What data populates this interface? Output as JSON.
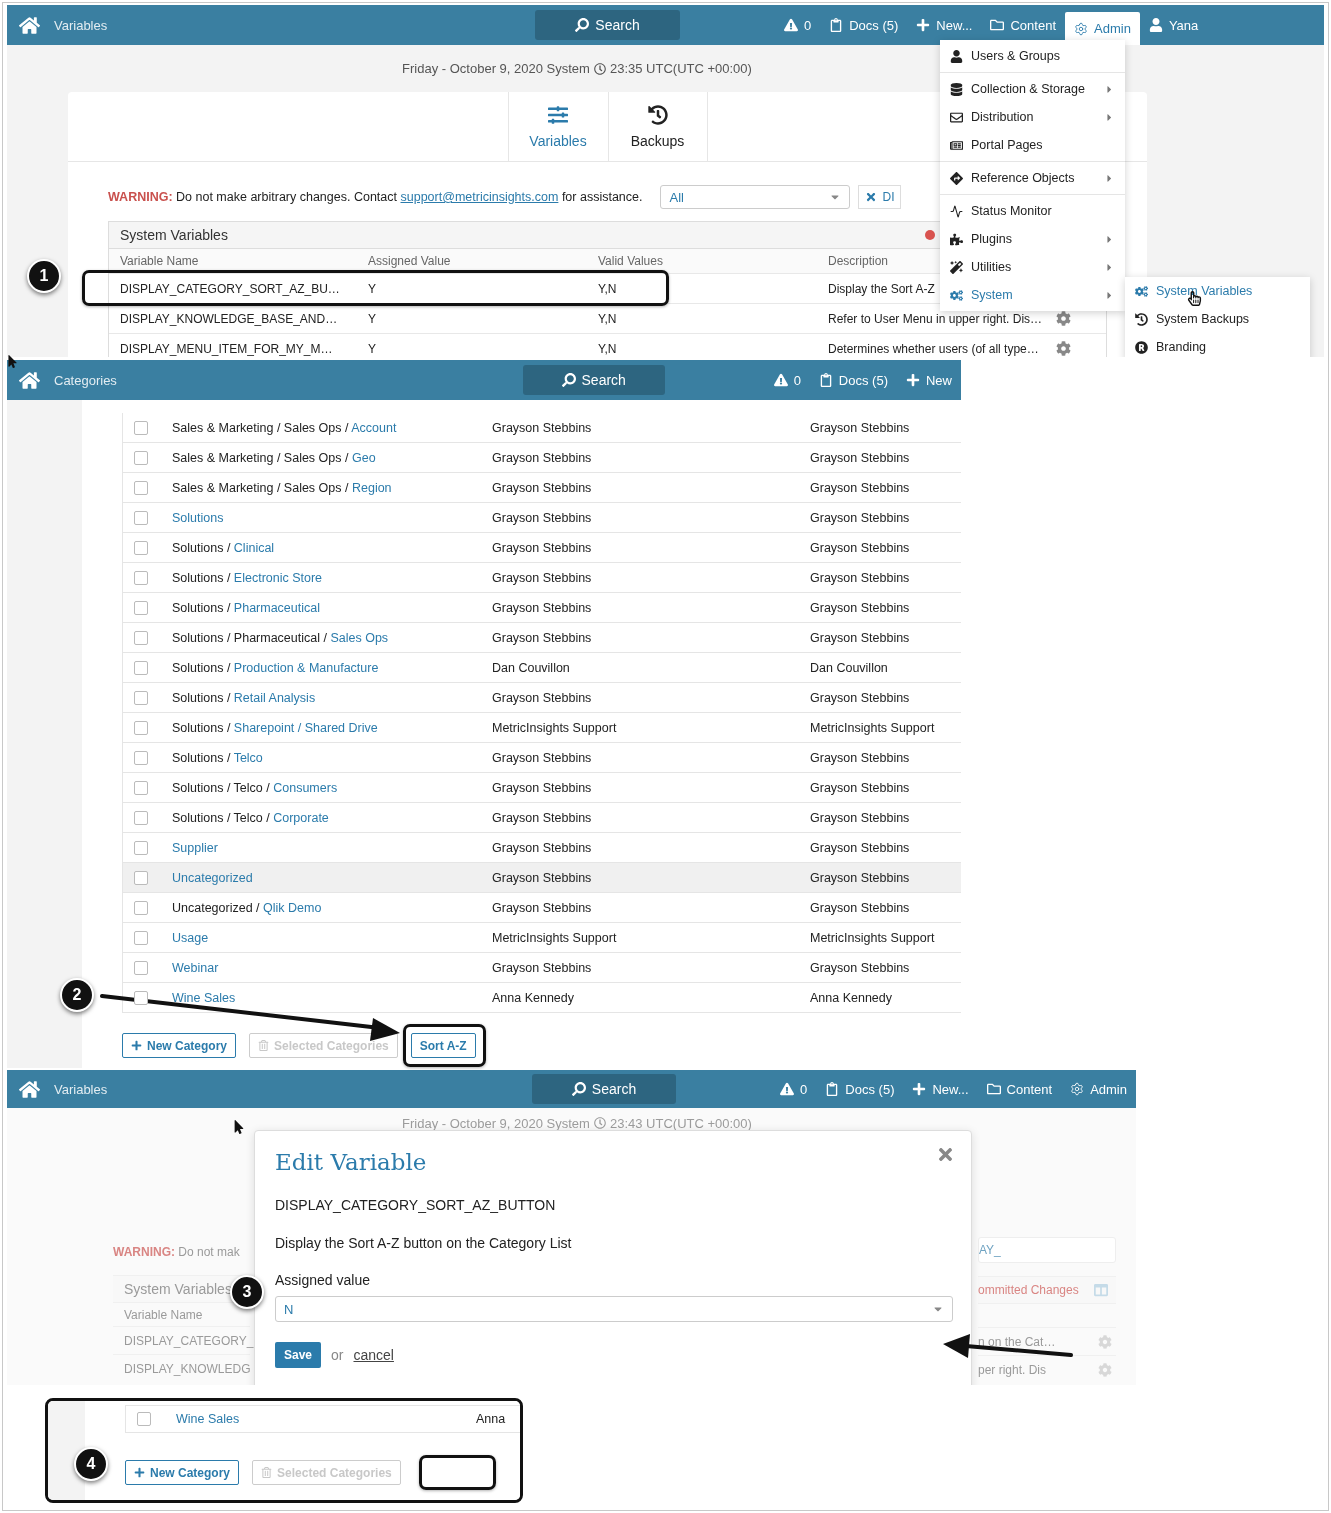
{
  "variables_screen": {
    "topbar": {
      "title": "Variables",
      "search": "Search",
      "nav": [
        {
          "kind": "alert",
          "label": "0",
          "selected": false
        },
        {
          "kind": "docs",
          "label": "Docs (5)",
          "selected": false
        },
        {
          "kind": "new",
          "label": "New...",
          "selected": false
        },
        {
          "kind": "content",
          "label": "Content",
          "selected": false
        },
        {
          "kind": "admin",
          "label": "Admin",
          "selected": true
        },
        {
          "kind": "user",
          "label": "Yana",
          "selected": false
        }
      ]
    },
    "datetime": {
      "date": "Friday - October 9, 2020 System",
      "time": "23:35 UTC(UTC +00:00)"
    },
    "tabs": [
      {
        "kind": "sliders",
        "label": "Variables",
        "selected": true
      },
      {
        "kind": "history",
        "label": "Backups",
        "selected": false
      }
    ],
    "warning": {
      "label": "WARNING:",
      "text": "Do not make arbitrary changes. Contact",
      "link": "support@metricinsights.com",
      "text_end": "for assistance."
    },
    "filter": {
      "value": "All"
    },
    "clear_button": "DI",
    "table": {
      "title": "System Variables",
      "columns": [
        "Variable Name",
        "Assigned Value",
        "Valid Values",
        "Description"
      ],
      "rows": [
        {
          "cells": [
            "DISPLAY_CATEGORY_SORT_AZ_BU…",
            "Y",
            "Y,N",
            "Display the Sort A-Z"
          ],
          "gear": false
        },
        {
          "cells": [
            "DISPLAY_KNOWLEDGE_BASE_AND…",
            "Y",
            "Y,N",
            "Refer to User Menu in upper right. Dis…"
          ],
          "gear": true
        },
        {
          "cells": [
            "DISPLAY_MENU_ITEM_FOR_MY_M…",
            "Y",
            "Y,N",
            "Determines whether users (of all type…"
          ],
          "gear": true
        }
      ]
    },
    "admin_menu": [
      [
        {
          "kind": "user",
          "label": "Users & Groups",
          "submenu": false,
          "selected": false
        }
      ],
      [
        {
          "kind": "database",
          "label": "Collection & Storage",
          "submenu": true,
          "selected": false
        },
        {
          "kind": "mail",
          "label": "Distribution",
          "submenu": true,
          "selected": false
        },
        {
          "kind": "newspaper",
          "label": "Portal Pages",
          "submenu": false,
          "selected": false
        }
      ],
      [
        {
          "kind": "signpost",
          "label": "Reference Objects",
          "submenu": true,
          "selected": false
        }
      ],
      [
        {
          "kind": "pulse",
          "label": "Status Monitor",
          "submenu": false,
          "selected": false
        },
        {
          "kind": "puzzle",
          "label": "Plugins",
          "submenu": true,
          "selected": false
        },
        {
          "kind": "wand",
          "label": "Utilities",
          "submenu": true,
          "selected": false
        },
        {
          "kind": "gears",
          "label": "System",
          "submenu": true,
          "selected": true
        }
      ]
    ],
    "submenu": [
      {
        "kind": "gears",
        "label": "System Variables",
        "selected": true
      },
      {
        "kind": "history",
        "label": "System Backups",
        "selected": false
      },
      {
        "kind": "registered",
        "label": "Branding",
        "selected": false
      }
    ]
  },
  "categories_screen": {
    "topbar": {
      "title": "Categories",
      "search": "Search",
      "nav": [
        {
          "kind": "alert",
          "label": "0",
          "selected": false
        },
        {
          "kind": "docs",
          "label": "Docs (5)",
          "selected": false
        },
        {
          "kind": "new",
          "label": "New",
          "selected": false
        }
      ]
    },
    "rows": [
      {
        "path": "Sales & Marketing / Sales Ops /",
        "name": "Account",
        "column_2": "Grayson Stebbins",
        "column_3": "Grayson Stebbins",
        "checked": false,
        "highlighted": false
      },
      {
        "path": "Sales & Marketing / Sales Ops /",
        "name": "Geo",
        "column_2": "Grayson Stebbins",
        "column_3": "Grayson Stebbins",
        "checked": false,
        "highlighted": false
      },
      {
        "path": "Sales & Marketing / Sales Ops /",
        "name": "Region",
        "column_2": "Grayson Stebbins",
        "column_3": "Grayson Stebbins",
        "checked": false,
        "highlighted": false
      },
      {
        "name": "Solutions",
        "column_2": "Grayson Stebbins",
        "column_3": "Grayson Stebbins",
        "checked": false,
        "highlighted": false
      },
      {
        "path": "Solutions /",
        "name": "Clinical",
        "column_2": "Grayson Stebbins",
        "column_3": "Grayson Stebbins",
        "checked": false,
        "highlighted": false
      },
      {
        "path": "Solutions /",
        "name": "Electronic Store",
        "column_2": "Grayson Stebbins",
        "column_3": "Grayson Stebbins",
        "checked": false,
        "highlighted": false
      },
      {
        "path": "Solutions /",
        "name": "Pharmaceutical",
        "column_2": "Grayson Stebbins",
        "column_3": "Grayson Stebbins",
        "checked": false,
        "highlighted": false
      },
      {
        "path": "Solutions / Pharmaceutical /",
        "name": "Sales Ops",
        "column_2": "Grayson Stebbins",
        "column_3": "Grayson Stebbins",
        "checked": false,
        "highlighted": false
      },
      {
        "path": "Solutions /",
        "name": "Production & Manufacture",
        "column_2": "Dan Couvillon",
        "column_3": "Dan Couvillon",
        "checked": false,
        "highlighted": false
      },
      {
        "path": "Solutions /",
        "name": "Retail Analysis",
        "column_2": "Grayson Stebbins",
        "column_3": "Grayson Stebbins",
        "checked": false,
        "highlighted": false
      },
      {
        "path": "Solutions /",
        "name": "Sharepoint / Shared Drive",
        "column_2": "MetricInsights Support",
        "column_3": "MetricInsights Support",
        "checked": false,
        "highlighted": false
      },
      {
        "path": "Solutions /",
        "name": "Telco",
        "column_2": "Grayson Stebbins",
        "column_3": "Grayson Stebbins",
        "checked": false,
        "highlighted": false
      },
      {
        "path": "Solutions / Telco /",
        "name": "Consumers",
        "column_2": "Grayson Stebbins",
        "column_3": "Grayson Stebbins",
        "checked": false,
        "highlighted": false
      },
      {
        "path": "Solutions / Telco /",
        "name": "Corporate",
        "column_2": "Grayson Stebbins",
        "column_3": "Grayson Stebbins",
        "checked": false,
        "highlighted": false
      },
      {
        "name": "Supplier",
        "column_2": "Grayson Stebbins",
        "column_3": "Grayson Stebbins",
        "checked": false,
        "highlighted": false
      },
      {
        "name": "Uncategorized",
        "column_2": "Grayson Stebbins",
        "column_3": "Grayson Stebbins",
        "checked": false,
        "highlighted": true
      },
      {
        "path": "Uncategorized /",
        "name": "Qlik Demo",
        "column_2": "Grayson Stebbins",
        "column_3": "Grayson Stebbins",
        "checked": false,
        "highlighted": false
      },
      {
        "name": "Usage",
        "column_2": "MetricInsights Support",
        "column_3": "MetricInsights Support",
        "checked": false,
        "highlighted": false
      },
      {
        "name": "Webinar",
        "column_2": "Grayson Stebbins",
        "column_3": "Grayson Stebbins",
        "checked": false,
        "highlighted": false
      },
      {
        "name": "Wine Sales",
        "column_2": "Anna Kennedy",
        "column_3": "Anna Kennedy",
        "checked": false,
        "highlighted": false
      }
    ],
    "buttons": [
      {
        "kind": "add",
        "label": "New Category",
        "disabled": false
      },
      {
        "kind": "delete",
        "label": "Selected Categories",
        "disabled": true
      },
      {
        "kind": "plain",
        "label": "Sort A-Z",
        "disabled": false
      }
    ]
  },
  "edit_screen": {
    "topbar": {
      "title": "Variables",
      "search": "Search",
      "nav": [
        {
          "kind": "alert",
          "label": "0",
          "selected": false
        },
        {
          "kind": "docs",
          "label": "Docs (5)",
          "selected": false
        },
        {
          "kind": "new",
          "label": "New...",
          "selected": false
        },
        {
          "kind": "content",
          "label": "Content",
          "selected": false
        },
        {
          "kind": "admin",
          "label": "Admin",
          "selected": false
        }
      ]
    },
    "background": {
      "date": "Friday - October 9, 2020 System",
      "time": "23:43 UTC(UTC +00:00)",
      "warning_label": "WARNING:",
      "warning_text": "Do not mak",
      "table_title": "System Variables",
      "column": "Variable Name",
      "rows_left": [
        "DISPLAY_CATEGORY_",
        "DISPLAY_KNOWLEDG"
      ],
      "search_value": "AY_",
      "changes": "ommitted Changes",
      "rows_right": [
        "n on the Cat…",
        "per right. Dis"
      ]
    },
    "modal": {
      "title": "Edit Variable",
      "name": "DISPLAY_CATEGORY_SORT_AZ_BUTTON",
      "description": "Display the Sort A-Z button on the Category List",
      "field_label": "Assigned value",
      "value": "N",
      "save": "Save",
      "or": "or",
      "cancel": "cancel"
    }
  },
  "inset": {
    "row": {
      "name": "Wine Sales",
      "column_2": "Anna",
      "checked": false,
      "highlighted": false
    },
    "buttons": [
      {
        "kind": "add",
        "label": "New Category",
        "disabled": false
      },
      {
        "kind": "delete",
        "label": "Selected Categories",
        "disabled": true
      }
    ]
  },
  "callouts": [
    "1",
    "2",
    "3",
    "4"
  ]
}
